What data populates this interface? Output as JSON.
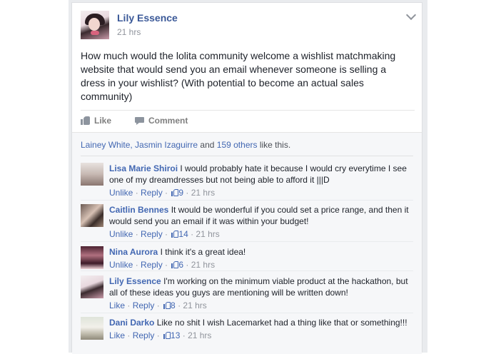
{
  "post": {
    "author": "Lily Essence",
    "time": "21 hrs",
    "text": "How much would the lolita community welcome a wishlist matchmaking website that would send you an email whenever someone is selling a dress in your wishlist? (With potential to become an actual sales community)",
    "menu_icon": "chevron-down-icon"
  },
  "actions": {
    "like_label": "Like",
    "comment_label": "Comment"
  },
  "likes": {
    "names": "Lainey White, Jasmin Izaguirre",
    "and": " and ",
    "others": "159 others",
    "suffix": " like this."
  },
  "comments": [
    {
      "name": "Lisa Marie Shiroi",
      "text": "I would probably hate it because I would cry everytime I see one of my dreamdresses but not being able to afford it |||D",
      "action": "Unlike",
      "reply": "Reply",
      "likes": "9",
      "time": "21 hrs"
    },
    {
      "name": "Caitlin Bennes",
      "text": "It would be wonderful if you could set a price range, and then it would send you an email if it was within your budget!",
      "action": "Unlike",
      "reply": "Reply",
      "likes": "14",
      "time": "21 hrs"
    },
    {
      "name": "Nina Aurora",
      "text": "I think it's a great idea!",
      "action": "Unlike",
      "reply": "Reply",
      "likes": "6",
      "time": "21 hrs"
    },
    {
      "name": "Lily Essence",
      "text": "I'm working on the minimum viable product at the hackathon, but all of these ideas you guys are mentioning will be written down!",
      "action": "Like",
      "reply": "Reply",
      "likes": "8",
      "time": "21 hrs"
    },
    {
      "name": "Dani Darko",
      "text": "Like no shit I wish Lacemarket had a thing like that or something!!!",
      "action": "Like",
      "reply": "Reply",
      "likes": "13",
      "time": "21 hrs"
    }
  ],
  "colors": {
    "link": "#4267b2",
    "author": "#3b5998",
    "muted": "#90949c",
    "feedback_bg": "#f6f7f9"
  }
}
